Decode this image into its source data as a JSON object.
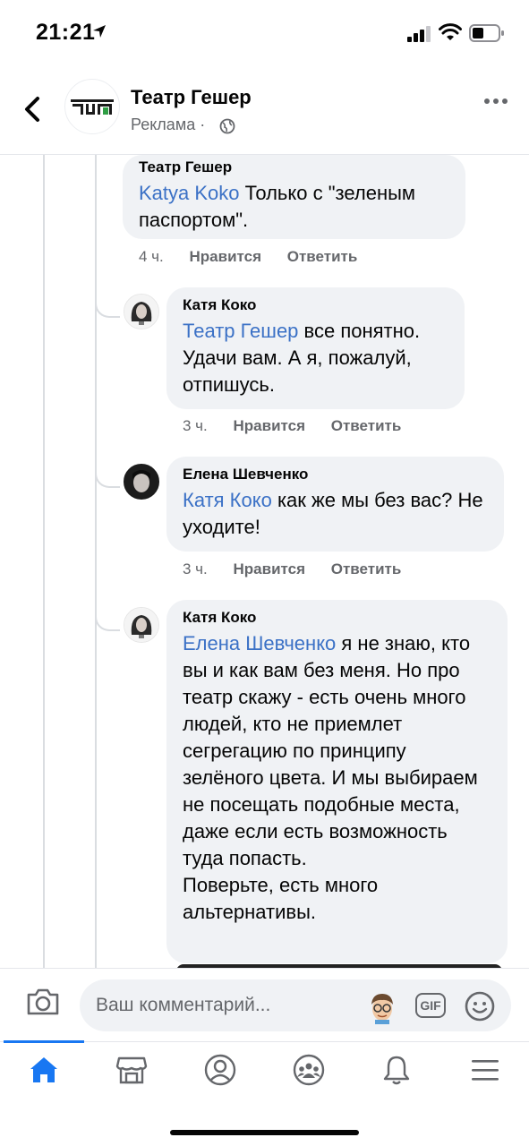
{
  "status_bar": {
    "time": "21:21"
  },
  "header": {
    "page_name": "Театр Гешер",
    "subtitle": "Реклама · "
  },
  "comments": [
    {
      "author": "Театр Гешер",
      "mention": "Katya Koko",
      "text": " Только с \"зеленым паспортом\".",
      "time": "4 ч.",
      "like": "Нравится",
      "reply": "Ответить"
    },
    {
      "author": "Катя Коко",
      "mention": "Театр Гешер",
      "text": " все понятно. Удачи вам. А я, пожалуй, отпишусь.",
      "time": "3 ч.",
      "like": "Нравится",
      "reply": "Ответить"
    },
    {
      "author": "Елена Шевченко",
      "mention": "Катя Коко",
      "text": " как же мы без вас? Не уходите!",
      "time": "3 ч.",
      "like": "Нравится",
      "reply": "Ответить"
    },
    {
      "author": "Катя Коко",
      "mention": "Елена Шевченко",
      "text": " я не знаю, кто вы и как вам без меня. Но про театр скажу - есть очень много людей, кто не приемлет сегрегацию по принципу зелёного цвета. И мы выбираем не посещать подобные места, даже если есть возможность туда попасть.",
      "text2": "Поверьте, есть много альтернативы."
    }
  ],
  "composer": {
    "placeholder": "Ваш комментарий...",
    "gif_label": "GIF"
  },
  "nav": {
    "items": [
      "home-icon",
      "marketplace-icon",
      "profile-icon",
      "groups-icon",
      "notifications-icon",
      "menu-icon"
    ],
    "active_color": "#1877f2"
  }
}
